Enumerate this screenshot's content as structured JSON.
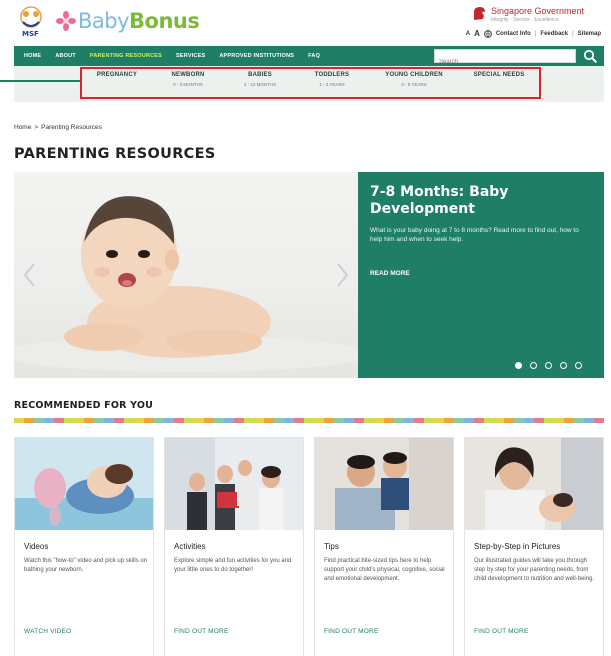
{
  "header": {
    "msf_logo_text": "MSF",
    "brand_baby": "Baby",
    "brand_bonus": "Bonus",
    "gov_title": "Singapore Government",
    "gov_subtitle": "Integrity · Service · Excellence",
    "font_small": "A",
    "font_large": "A",
    "contact_label": "Contact Info",
    "feedback_label": "Feedback",
    "sitemap_label": "Sitemap",
    "sep": "|"
  },
  "nav": {
    "items": [
      {
        "label": "HOME"
      },
      {
        "label": "ABOUT"
      },
      {
        "label": "PARENTING RESOURCES",
        "active": true
      },
      {
        "label": "SERVICES"
      },
      {
        "label": "APPROVED INSTITUTIONS"
      },
      {
        "label": "FAQ"
      }
    ],
    "search_placeholder": "Search"
  },
  "subnav": {
    "items": [
      {
        "label": "PREGNANCY",
        "age": ""
      },
      {
        "label": "NEWBORN",
        "age": "0 - 3 MONTHS"
      },
      {
        "label": "BABIES",
        "age": "3 - 12 MONTHS"
      },
      {
        "label": "TODDLERS",
        "age": "1 - 3 YEARS"
      },
      {
        "label": "YOUNG CHILDREN",
        "age": "3 - 6 YEARS"
      },
      {
        "label": "SPECIAL NEEDS",
        "age": ""
      }
    ]
  },
  "breadcrumb": {
    "home": "Home",
    "separator": ">",
    "current": "Parenting Resources"
  },
  "page_title": "PARENTING RESOURCES",
  "hero": {
    "title": "7-8 Months: Baby Development",
    "description": "What is your baby doing at 7 to 8 months? Read more to find out, how to help him and when to seek help.",
    "read_more": "READ MORE",
    "slide_count": 5,
    "active_slide": 1
  },
  "recommended": {
    "title": "RECOMMENDED FOR YOU",
    "cards": [
      {
        "title": "Videos",
        "desc": "Watch this \"how-to\" video and pick up skills on bathing your newborn.",
        "link": "WATCH VIDEO"
      },
      {
        "title": "Activities",
        "desc": "Explore simple and fun activities for you and your little ones to do together!",
        "link": "FIND OUT MORE"
      },
      {
        "title": "Tips",
        "desc": "Find practical bite-sized tips here to help support your child's physical, cognitive, social and emotional development.",
        "link": "FIND OUT MORE"
      },
      {
        "title": "Step-by-Step in Pictures",
        "desc": "Our illustrated guides will take you through step by step for your parenting needs, from child development to nutrition and well-being.",
        "link": "FIND OUT MORE"
      }
    ]
  },
  "colors": {
    "brand_green": "#1e7f66",
    "active_nav": "#d6ef5a",
    "highlight_border": "#d5252d",
    "gov_red": "#c0282d"
  }
}
